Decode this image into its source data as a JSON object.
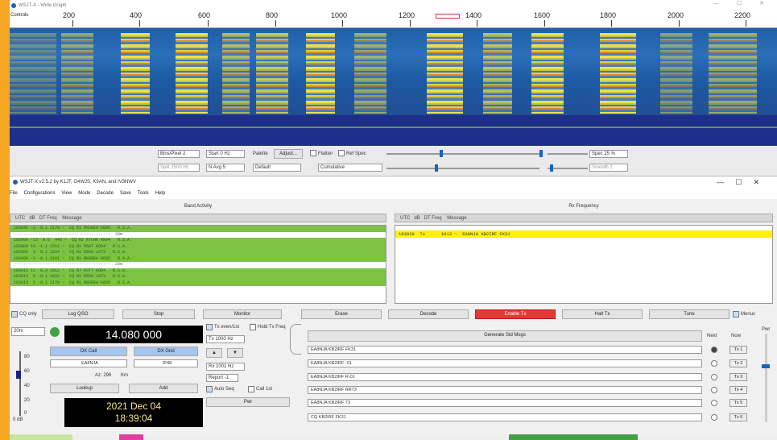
{
  "wide_graph": {
    "title": "WSJT-X - Wide Graph",
    "controls": "—   ☐   ✕",
    "scale_label": "☐ Controls",
    "freq_ticks": [
      "200",
      "400",
      "600",
      "800",
      "1000",
      "1200",
      "1400",
      "1600",
      "1800",
      "2000",
      "2200"
    ],
    "bins_per_pixel": "Bins/Pixel 2",
    "start": "Start 0 Hz",
    "palette": "Palette",
    "adjust": "Adjust...",
    "flatten": "Flatten",
    "ref_spec": "Ref Spec",
    "spec": "Spec 25 %",
    "split": "Split 2500 Hz",
    "n_avg": "N Avg 5",
    "palette_value": "Default",
    "cumulative": "Cumulative",
    "smooth": "Smooth 1"
  },
  "main": {
    "title": "WSJT-X  v2.5.2  by K1JT, G4WJS, K9AN, and IV3NWV",
    "menu": [
      "File",
      "Configurations",
      "View",
      "Mode",
      "Decode",
      "Save",
      "Tools",
      "Help"
    ],
    "band_activity_title": "Band Activity",
    "rx_frequency_title": "Rx Frequency",
    "col_header": "UTC   dB   DT Freq    Message",
    "band_rows": [
      {
        "text": "183845 -3 -0.1 2178 ~  CQ R1 RN3DEA KO85   R.S.A.",
        "cls": "g"
      },
      {
        "text": "----------------------------------------  20m",
        "cls": "sep"
      },
      {
        "text": "183900 -13  0.6  448 ~  CQ R2 R7CHK KN94   R.S.A.",
        "cls": "g"
      },
      {
        "text": "183900 10 -1.1 1211 ~  CQ R1 R5AT KO94   R.S.A.",
        "cls": "g"
      },
      {
        "text": "183900  3 -0.1 1634 ~  CQ R1 R5DA LO73   R.S.A.",
        "cls": "g"
      },
      {
        "text": "183900 -3 -0.1 2181 ~  CQ R1 RN3DEA KO85   R.S.A.",
        "cls": "g"
      },
      {
        "text": "----------------------------------------  20m",
        "cls": "sep"
      },
      {
        "text": "183915 11  0.3 1012 ~  CQ R7 R3TT KO94   R.S.A.",
        "cls": "g"
      },
      {
        "text": "183915  6 -0.1 1632 ~  CQ R1 R5DA LO73   R.S.A.",
        "cls": "g"
      },
      {
        "text": "183915  5 -0.1 2178 ~  CQ R1 RN3DEA KO85   R.S.A.",
        "cls": "g"
      }
    ],
    "rx_row": "183930  Tx      1013 ~  EA8NJA KB2IRF FK31",
    "buttons": {
      "cq_only": "CQ only",
      "log_qso": "Log QSO",
      "stop": "Stop",
      "monitor": "Monitor",
      "erase": "Erase",
      "decode": "Decode",
      "enable_tx": "Enable Tx",
      "halt_tx": "Halt Tx",
      "tune": "Tune",
      "menus": "Menus"
    },
    "band": "20m",
    "freq": "14.080 000",
    "dx_call_label": "DX Call",
    "dx_grid_label": "DX Grid",
    "dx_call": "EA8NJA",
    "dx_grid": "IP48",
    "az": "Az: 296",
    "km": "Km",
    "lookup": "Lookup",
    "add": "Add",
    "date": "2021 Dec 04",
    "time": "18:39:04",
    "tx_even": "Tx even/1st",
    "hold_tx": "Hold Tx Freq",
    "tx_freq": "Tx 1000 Hz",
    "rx_freq": "Rx 1001 Hz",
    "report": "Report -1",
    "auto_seq": "Auto Seq",
    "call_1st": "Call 1st",
    "pwr": "Pwr",
    "gen_std": "Generate Std Msgs",
    "next": "Next",
    "now": "Now",
    "messages": [
      "EA8NJA KB2IRF FK31",
      "EA8NJA KB2IRF -01",
      "EA8NJA KB2IRF R-01",
      "EA8NJA KB2IRF RR73",
      "EA8NJA KB2IRF 73",
      "CQ KB2IRF FK31"
    ],
    "tx_labels": [
      "Tx 1",
      "Tx 2",
      "Tx 3",
      "Tx 4",
      "Tx 5",
      "Tx 6"
    ],
    "meter_labels": [
      "80",
      "60",
      "40",
      "20",
      "0"
    ],
    "meter_value": "0 dB",
    "tx_label": "Tx"
  }
}
